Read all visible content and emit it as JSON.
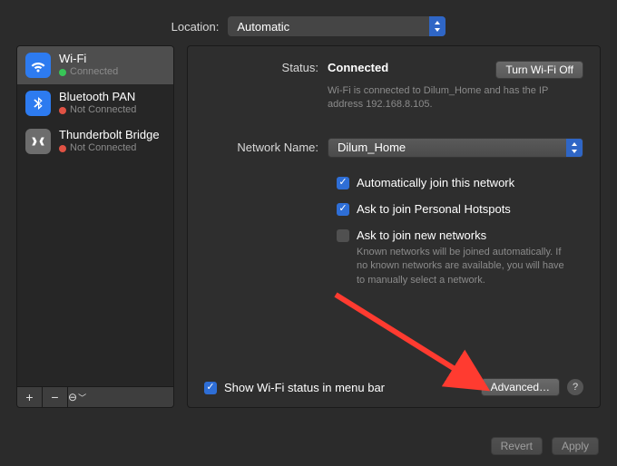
{
  "location": {
    "label": "Location:",
    "value": "Automatic"
  },
  "services": [
    {
      "name": "Wi-Fi",
      "status": "Connected",
      "status_color": "green",
      "icon": "wifi",
      "active": true
    },
    {
      "name": "Bluetooth PAN",
      "status": "Not Connected",
      "status_color": "red",
      "icon": "bt",
      "active": false
    },
    {
      "name": "Thunderbolt Bridge",
      "status": "Not Connected",
      "status_color": "red",
      "icon": "tb",
      "active": false
    }
  ],
  "sidebar_footer": {
    "add": "+",
    "remove": "−",
    "actions": "⊙﹀"
  },
  "detail": {
    "status_label": "Status:",
    "status_value": "Connected",
    "toggle_button": "Turn Wi-Fi Off",
    "status_sub": "Wi-Fi is connected to Dilum_Home and has the IP address 192.168.8.105.",
    "network_label": "Network Name:",
    "network_value": "Dilum_Home",
    "auto_join": "Automatically join this network",
    "personal_hotspots": "Ask to join Personal Hotspots",
    "ask_new": "Ask to join new networks",
    "ask_new_sub": "Known networks will be joined automatically. If no known networks are available, you will have to manually select a network.",
    "show_status": "Show Wi-Fi status in menu bar",
    "advanced": "Advanced…",
    "help": "?"
  },
  "footer": {
    "revert": "Revert",
    "apply": "Apply"
  }
}
